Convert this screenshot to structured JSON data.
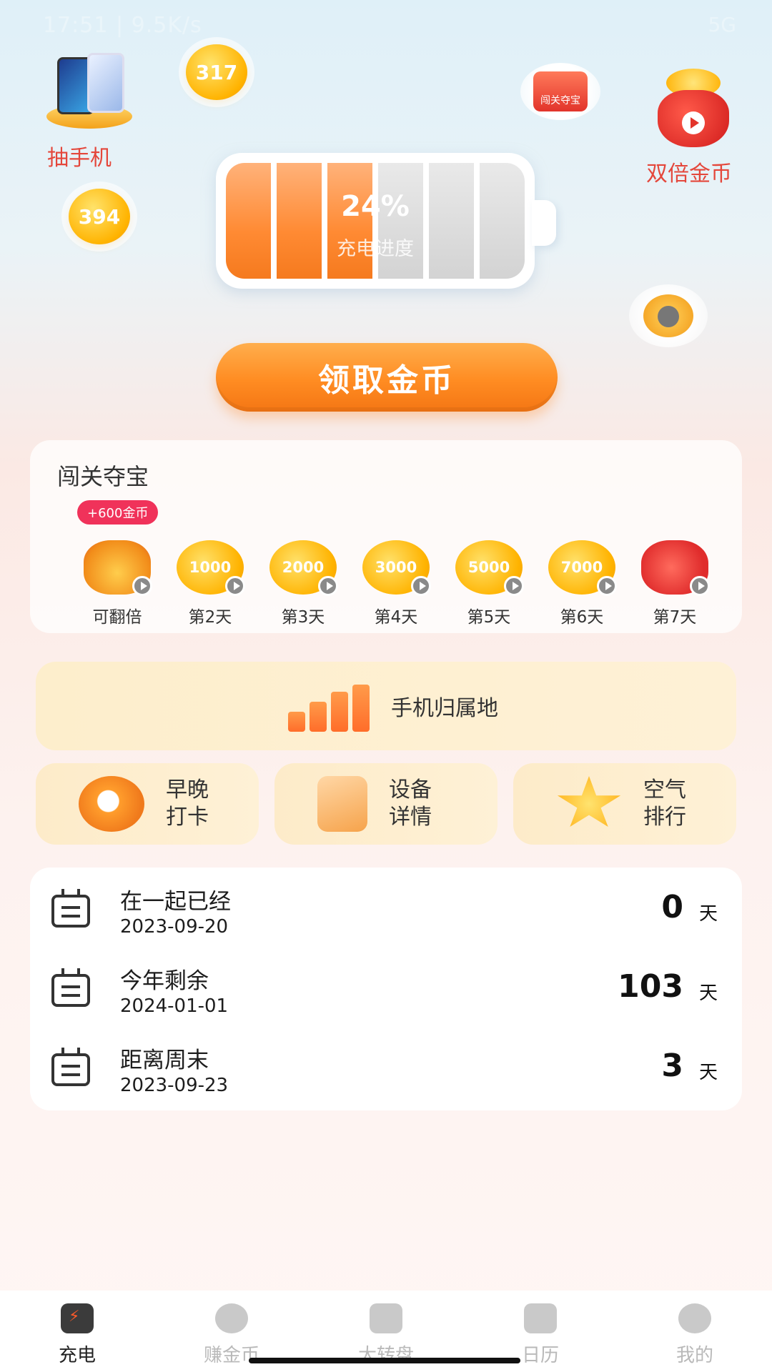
{
  "status_bar": {
    "left": "17:51 | 9.5K/s",
    "right": "5G"
  },
  "top": {
    "lottery_label": "抽手机",
    "double_coins_label": "双倍金币",
    "coin_bubble_1": "317",
    "coin_bubble_2": "394",
    "trophy_label": "闯关夺宝"
  },
  "battery": {
    "percent": "24%",
    "percent_value": 24,
    "subtitle": "充电进度",
    "cells_total": 6,
    "cells_on": 3
  },
  "claim_button": "领取金币",
  "treasure": {
    "title": "闯关夺宝",
    "bonus_tag": "+600金币",
    "days": [
      {
        "coin": "",
        "label": "可翻倍",
        "kind": "gold-pile"
      },
      {
        "coin": "1000",
        "label": "第2天",
        "kind": "coin"
      },
      {
        "coin": "2000",
        "label": "第3天",
        "kind": "coin"
      },
      {
        "coin": "3000",
        "label": "第4天",
        "kind": "coin"
      },
      {
        "coin": "5000",
        "label": "第5天",
        "kind": "coin"
      },
      {
        "coin": "7000",
        "label": "第6天",
        "kind": "coin"
      },
      {
        "coin": "",
        "label": "第7天",
        "kind": "bag"
      }
    ]
  },
  "location_card": {
    "label": "手机归属地"
  },
  "tiles": [
    {
      "line1": "早晚",
      "line2": "打卡"
    },
    {
      "line1": "设备",
      "line2": "详情"
    },
    {
      "line1": "空气",
      "line2": "排行"
    }
  ],
  "counters": [
    {
      "name": "在一起已经",
      "date": "2023-09-20",
      "value": "0",
      "unit": "天"
    },
    {
      "name": "今年剩余",
      "date": "2024-01-01",
      "value": "103",
      "unit": "天"
    },
    {
      "name": "距离周末",
      "date": "2023-09-23",
      "value": "3",
      "unit": "天"
    }
  ],
  "bottom_nav": [
    {
      "label": "充电",
      "active": true
    },
    {
      "label": "赚金币",
      "active": false
    },
    {
      "label": "大转盘",
      "active": false
    },
    {
      "label": "日历",
      "active": false
    },
    {
      "label": "我的",
      "active": false
    }
  ]
}
